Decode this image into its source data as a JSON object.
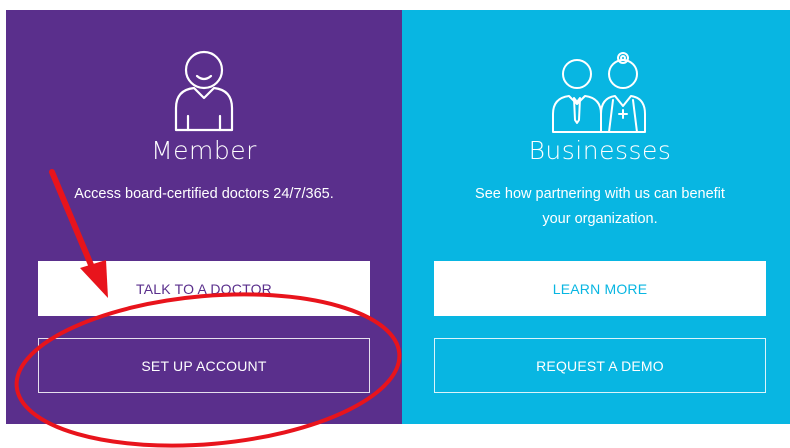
{
  "member": {
    "icon": "person-icon",
    "title": "Member",
    "description": "Access board-certified doctors 24/7/365.",
    "primary_button": "TALK TO A DOCTOR",
    "secondary_button": "SET UP ACCOUNT",
    "color": "#5a2f8c"
  },
  "businesses": {
    "icon": "business-and-doctor-icon",
    "title": "Businesses",
    "description": "See how partnering with us can benefit your organization.",
    "primary_button": "LEARN MORE",
    "secondary_button": "REQUEST A DEMO",
    "color": "#08b6e2"
  },
  "annotation": {
    "color": "#e8141c",
    "shapes": [
      "arrow",
      "ellipse"
    ]
  }
}
